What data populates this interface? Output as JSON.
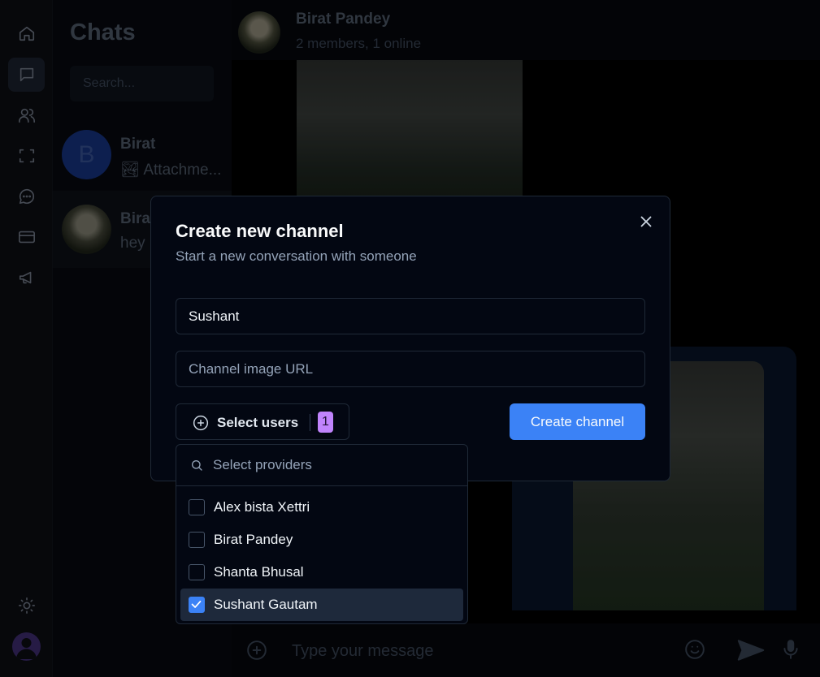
{
  "sidebar": {
    "items": [
      {
        "icon": "home-icon"
      },
      {
        "icon": "chat-icon",
        "active": true
      },
      {
        "icon": "users-icon"
      },
      {
        "icon": "scan-icon"
      },
      {
        "icon": "message-circle-icon"
      },
      {
        "icon": "credit-card-icon"
      },
      {
        "icon": "megaphone-icon"
      }
    ],
    "bottom": [
      {
        "icon": "sun-icon"
      },
      {
        "icon": "user-avatar"
      }
    ]
  },
  "chat_list": {
    "title": "Chats",
    "search_placeholder": "Search...",
    "chats": [
      {
        "name": "Birat",
        "initial": "B",
        "last": "🏞 Attachme..."
      },
      {
        "name": "Birat",
        "last": "hey"
      }
    ]
  },
  "conversation": {
    "name": "Birat Pandey",
    "status": "2 members, 1 online",
    "composer_placeholder": "Type your message"
  },
  "dialog": {
    "title": "Create new channel",
    "description": "Start a new conversation with someone",
    "name_value": "Sushant",
    "image_placeholder": "Channel image URL",
    "select_users_label": "Select users",
    "selected_count": "1",
    "create_label": "Create channel"
  },
  "providers": {
    "search_placeholder": "Select providers",
    "options": [
      {
        "name": "Alex bista Xettri",
        "checked": false
      },
      {
        "name": "Birat Pandey",
        "checked": false
      },
      {
        "name": "Shanta Bhusal",
        "checked": false
      },
      {
        "name": "Sushant Gautam",
        "checked": true
      }
    ]
  },
  "colors": {
    "accent": "#3b82f6",
    "badge": "#c084fc",
    "dialog_bg": "#030712"
  }
}
